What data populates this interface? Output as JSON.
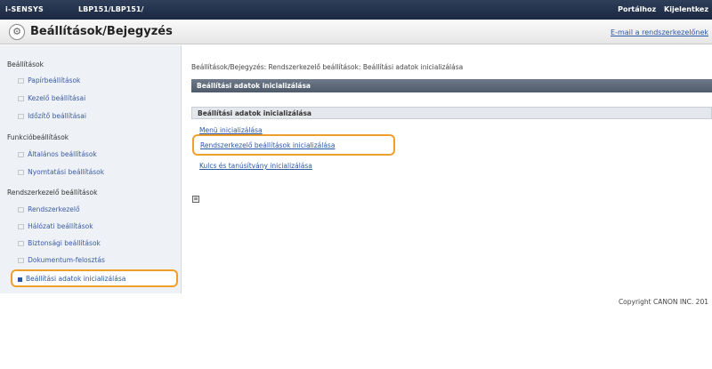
{
  "topbar": {
    "brand": "i-SENSYS",
    "model": "LBP151/LBP151/",
    "portal_link": "Portálhoz",
    "logout_link": "Kijelentkez"
  },
  "header": {
    "gear_icon": "gear-icon",
    "title": "Beállítások/Bejegyzés",
    "mail_link": "E-mail a rendszerkezelőnek"
  },
  "sidebar": {
    "sections": [
      {
        "heading": "Beállítások",
        "items": [
          "Papírbeállítások",
          "Kezelő beállításai",
          "Időzítő beállításai"
        ]
      },
      {
        "heading": "Funkcióbeállítások",
        "items": [
          "Általános beállítások",
          "Nyomtatási beállítások"
        ]
      },
      {
        "heading": "Rendszerkezelő beállítások",
        "items": [
          "Rendszerkezelő",
          "Hálózati beállítások",
          "Biztonsági beállítások",
          "Dokumentum-felosztás"
        ]
      }
    ],
    "selected": "Beállítási adatok inicializálása"
  },
  "main": {
    "breadcrumb": "Beállítások/Bejegyzés: Rendszerkezelő beállítások: Beállítási adatok inicializálása",
    "panel_title": "Beállítási adatok inicializálása",
    "subsection_title": "Beállítási adatok inicializálása",
    "links": [
      "Menü inicializálása",
      "Rendszerkezelő beállítások inicializálása",
      "Kulcs és tanúsítvány inicializálása"
    ]
  },
  "footer": {
    "copyright": "Copyright CANON INC. 201"
  }
}
